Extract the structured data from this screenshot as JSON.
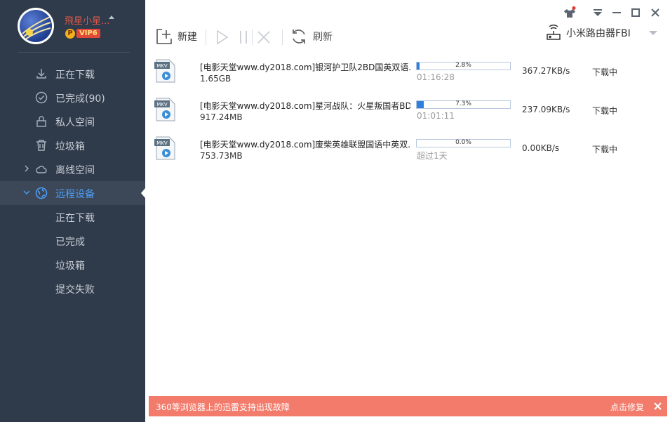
{
  "user": {
    "name": "飛星小星...",
    "vip_badge": "P",
    "vip_level": "VIP6"
  },
  "sidebar": {
    "items": [
      {
        "label": "正在下载",
        "icon": "download-icon"
      },
      {
        "label": "已完成(90)",
        "icon": "check-circle-icon"
      },
      {
        "label": "私人空间",
        "icon": "lock-icon"
      },
      {
        "label": "垃圾箱",
        "icon": "trash-icon"
      },
      {
        "label": "离线空间",
        "icon": "cloud-icon"
      },
      {
        "label": "远程设备",
        "icon": "globe-icon"
      }
    ],
    "remote_subitems": [
      {
        "label": "正在下载"
      },
      {
        "label": "已完成"
      },
      {
        "label": "垃圾箱"
      },
      {
        "label": "提交失败"
      }
    ]
  },
  "toolbar": {
    "new_label": "新建",
    "refresh_label": "刷新",
    "device_label": "小米路由器FBI"
  },
  "downloads": [
    {
      "name": "[电影天堂www.dy2018.com]银河护卫队2BD国英双语...",
      "size": "1.65GB",
      "progress": 0.028,
      "progress_text": "2.8%",
      "remaining": "01:16:28",
      "speed": "367.27KB/s",
      "status": "下载中"
    },
    {
      "name": "[电影天堂www.dy2018.com]星河战队：火星叛国者BD...",
      "size": "917.24MB",
      "progress": 0.073,
      "progress_text": "7.3%",
      "remaining": "01:01:11",
      "speed": "237.09KB/s",
      "status": "下载中"
    },
    {
      "name": "[电影天堂www.dy2018.com]废柴英雄联盟国语中英双...",
      "size": "753.73MB",
      "progress": 0.0,
      "progress_text": "0.0%",
      "remaining": "超过1天",
      "speed": "0.00KB/s",
      "status": "下载中"
    }
  ],
  "banner": {
    "message": "360等浏览器上的迅雷支持出现故障",
    "fix_label": "点击修复"
  },
  "colors": {
    "sidebar_bg": "#2f3a4a",
    "accent": "#4c9ef5",
    "progress_fill": "#2f7fdc",
    "banner_bg": "#f27b6b"
  }
}
